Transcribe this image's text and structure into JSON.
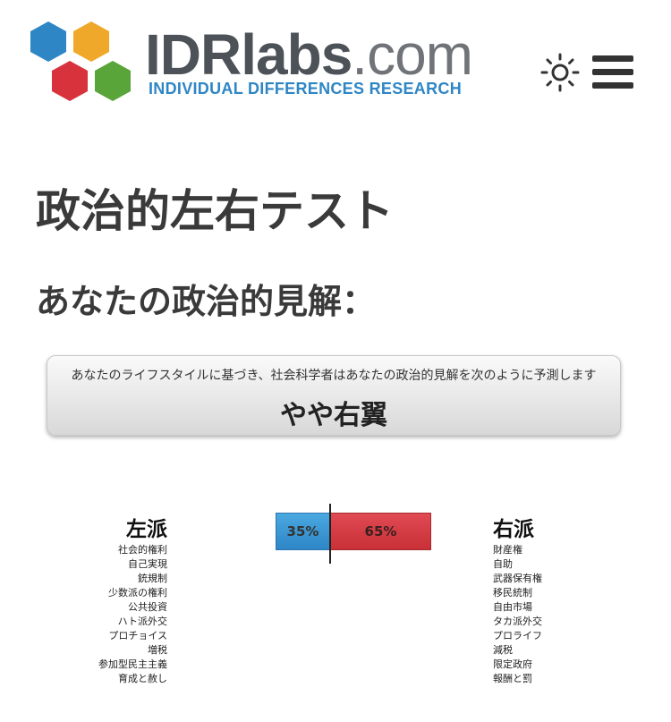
{
  "header": {
    "logo_bold": "IDRlabs",
    "logo_light": ".com",
    "logo_tagline": "INDIVIDUAL DIFFERENCES RESEARCH",
    "theme_icon": "sun-icon",
    "menu_icon": "hamburger-menu-icon",
    "colors": {
      "hex_blue": "#2f86c5",
      "hex_orange": "#f0a82a",
      "hex_red": "#d8333d",
      "hex_green": "#5aa53a"
    }
  },
  "page_title": "政治的左右テスト",
  "subtitle": "あなたの政治的見解：",
  "result": {
    "description": "あなたのライフスタイルに基づき、社会科学者はあなたの政治的見解を次のように予測します",
    "value": "やや右翼"
  },
  "scale": {
    "left": {
      "heading": "左派",
      "percent": 35,
      "label": "35%",
      "color": "#2e86c6",
      "items": [
        "社会的権利",
        "自己実現",
        "銃規制",
        "少数派の権利",
        "公共投資",
        "ハト派外交",
        "プロチョイス",
        "増税",
        "参加型民主主義",
        "育成と赦し"
      ]
    },
    "right": {
      "heading": "右派",
      "percent": 65,
      "label": "65%",
      "color": "#c93038",
      "items": [
        "財産権",
        "自助",
        "武器保有権",
        "移民統制",
        "自由市場",
        "タカ派外交",
        "プロライフ",
        "減税",
        "限定政府",
        "報酬と罰"
      ]
    }
  }
}
